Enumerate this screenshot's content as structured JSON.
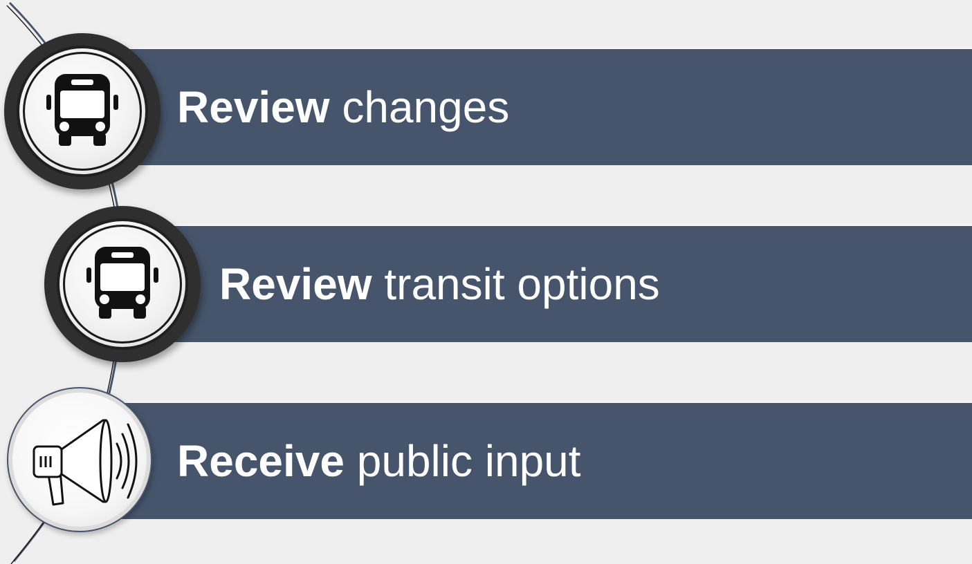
{
  "steps": [
    {
      "bold": "Review",
      "rest": " changes",
      "icon": "bus-icon"
    },
    {
      "bold": "Review",
      "rest": " transit options",
      "icon": "bus-icon"
    },
    {
      "bold": "Receive",
      "rest": " public input",
      "icon": "megaphone-icon"
    }
  ],
  "colors": {
    "band": "#46556b",
    "background": "#efefef",
    "icon": "#111111"
  }
}
